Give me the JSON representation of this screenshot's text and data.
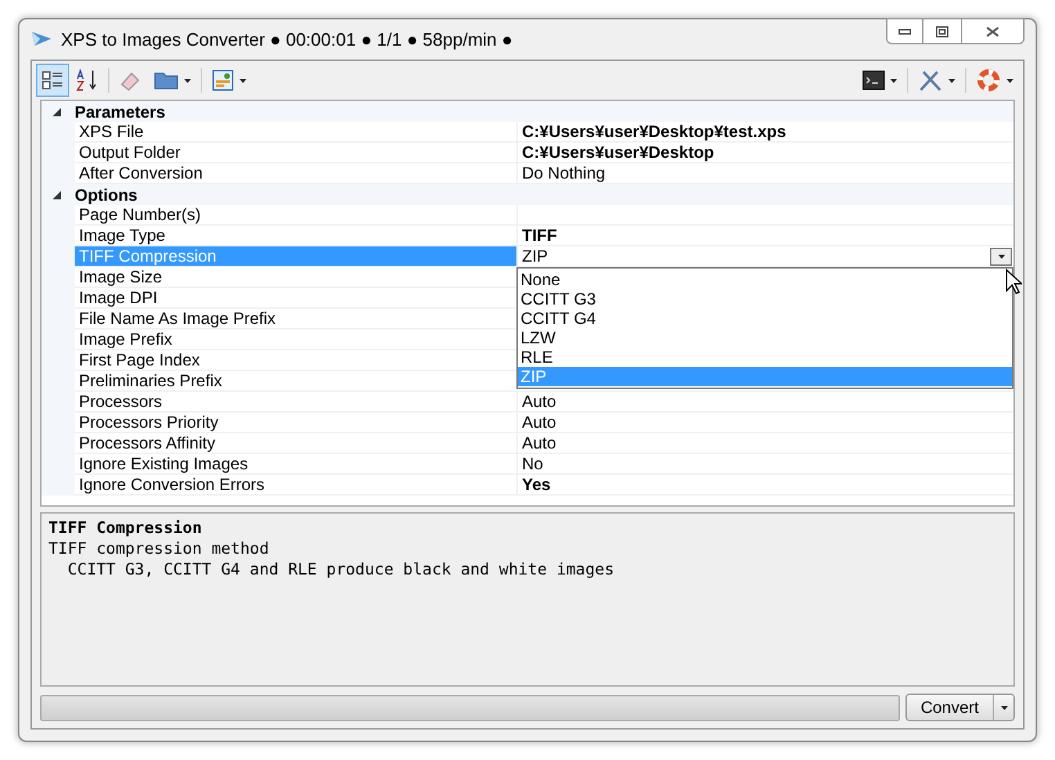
{
  "window": {
    "title": "XPS to Images Converter ● 00:00:01 ● 1/1 ● 58pp/min ●"
  },
  "toolbar": {
    "left": [
      {
        "kind": "categorized",
        "selected": true,
        "caret": false
      },
      {
        "kind": "alphabetical",
        "selected": false,
        "caret": false
      },
      {
        "kind": "eraser",
        "selected": false,
        "caret": false
      },
      {
        "kind": "folder",
        "selected": false,
        "caret": true
      },
      {
        "kind": "picture",
        "selected": false,
        "caret": true
      }
    ],
    "right": [
      {
        "kind": "terminal",
        "selected": false,
        "caret": true
      },
      {
        "kind": "tools",
        "selected": false,
        "caret": true
      },
      {
        "kind": "help",
        "selected": false,
        "caret": true
      }
    ]
  },
  "grid": {
    "categories": [
      {
        "name": "Parameters",
        "expanded": true,
        "rows": [
          {
            "name": "XPS File",
            "value": "C:¥Users¥user¥Desktop¥test.xps",
            "modified": true,
            "selected": false
          },
          {
            "name": "Output Folder",
            "value": "C:¥Users¥user¥Desktop",
            "modified": true,
            "selected": false
          },
          {
            "name": "After Conversion",
            "value": "Do Nothing",
            "modified": false,
            "selected": false
          }
        ]
      },
      {
        "name": "Options",
        "expanded": true,
        "rows": [
          {
            "name": "Page Number(s)",
            "selected": false
          },
          {
            "name": "Image Type",
            "value": "TIFF",
            "modified": true,
            "selected": false
          },
          {
            "name": "TIFF Compression",
            "value": "ZIP",
            "modified": false,
            "selected": true,
            "dropdown": {
              "options": [
                {
                  "label": "None",
                  "selected": false
                },
                {
                  "label": "CCITT G3",
                  "selected": false
                },
                {
                  "label": "CCITT G4",
                  "selected": false
                },
                {
                  "label": "LZW",
                  "selected": false
                },
                {
                  "label": "RLE",
                  "selected": false
                },
                {
                  "label": "ZIP",
                  "selected": true
                }
              ]
            }
          },
          {
            "name": "Image Size",
            "selected": false
          },
          {
            "name": "Image DPI",
            "selected": false
          },
          {
            "name": "File Name As Image Prefix",
            "selected": false
          },
          {
            "name": "Image Prefix",
            "selected": false
          },
          {
            "name": "First Page Index",
            "selected": false
          },
          {
            "name": "Preliminaries Prefix",
            "selected": false
          },
          {
            "name": "Processors",
            "value": "Auto",
            "modified": false,
            "selected": false
          },
          {
            "name": "Processors Priority",
            "value": "Auto",
            "modified": false,
            "selected": false
          },
          {
            "name": "Processors Affinity",
            "value": "Auto",
            "modified": false,
            "selected": false
          },
          {
            "name": "Ignore Existing Images",
            "value": "No",
            "modified": false,
            "selected": false
          },
          {
            "name": "Ignore Conversion Errors",
            "value": "Yes",
            "modified": true,
            "selected": false
          }
        ]
      }
    ]
  },
  "description": {
    "title": "TIFF Compression",
    "lines": [
      "TIFF compression method",
      "  CCITT G3, CCITT G4 and RLE produce black and white images"
    ]
  },
  "footer": {
    "progress": {
      "level": 0
    },
    "button": "Convert"
  }
}
